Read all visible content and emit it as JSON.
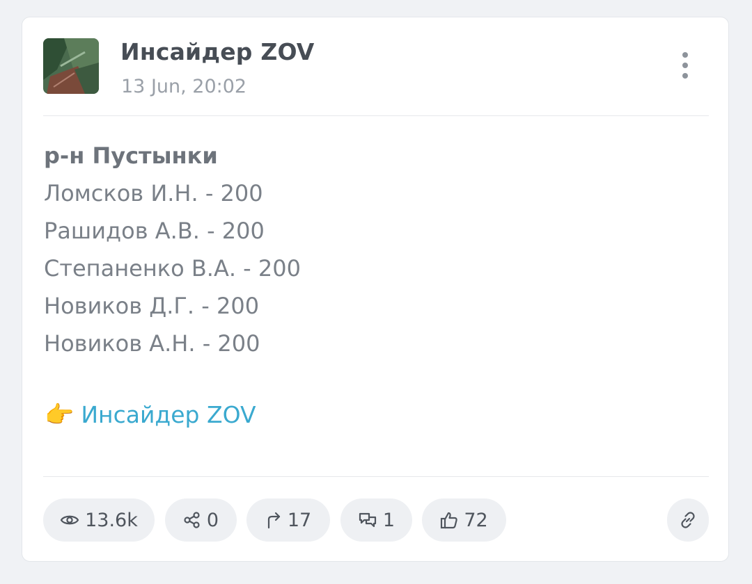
{
  "post": {
    "channel_name": "Инсайдер ZOV",
    "date": "13 Jun, 20:02",
    "heading": "р-н Пустынки",
    "lines": [
      "Ломсков И.Н. - 200",
      "Рашидов А.В. - 200",
      "Степаненко В.А. - 200",
      "Новиков Д.Г. - 200",
      "Новиков А.Н. - 200"
    ],
    "link_emoji": "👉",
    "link_text": "Инсайдер ZOV"
  },
  "stats": {
    "views": "13.6k",
    "shares": "0",
    "forwards": "17",
    "comments": "1",
    "reactions": "72"
  },
  "icons": [
    "avatar-image",
    "more-vertical-icon",
    "eye-icon",
    "share-icon",
    "forward-icon",
    "comment-icon",
    "thumbs-up-icon",
    "link-icon"
  ],
  "colors": {
    "background": "#f0f2f5",
    "card": "#ffffff",
    "link": "#3aa9cf",
    "text": "#7a8088",
    "pill": "#eef0f3"
  }
}
